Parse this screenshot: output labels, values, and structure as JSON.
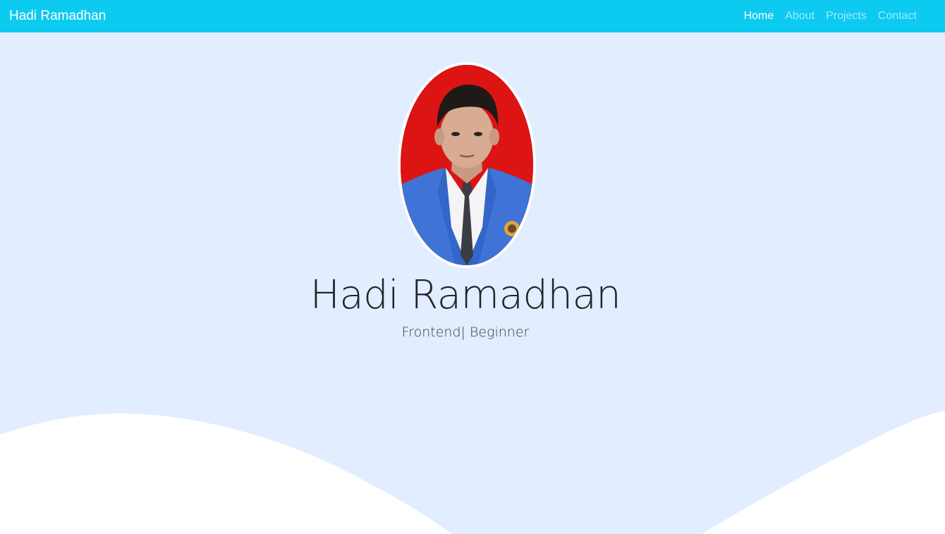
{
  "navbar": {
    "brand": "Hadi Ramadhan",
    "links": [
      {
        "label": "Home",
        "active": true
      },
      {
        "label": "About",
        "active": false
      },
      {
        "label": "Projects",
        "active": false
      },
      {
        "label": "Contact",
        "active": false
      }
    ]
  },
  "hero": {
    "name": "Hadi Ramadhan",
    "tagline": "Frontend| Beginner",
    "photo_icon": "profile-photo"
  },
  "colors": {
    "navbar_bg": "#0dcaf0",
    "hero_bg": "#e2edff",
    "wave": "#ffffff"
  }
}
